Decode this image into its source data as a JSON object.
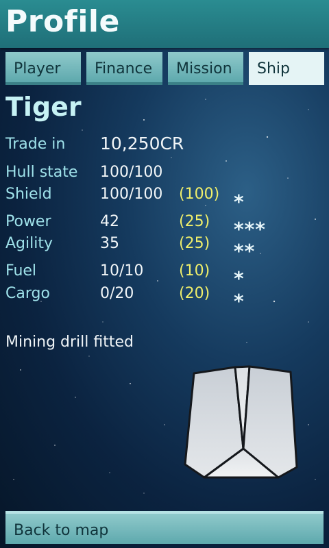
{
  "header": {
    "title": "Profile"
  },
  "tabs": [
    {
      "label": "Player"
    },
    {
      "label": "Finance"
    },
    {
      "label": "Mission"
    },
    {
      "label": "Ship",
      "active": true
    }
  ],
  "ship": {
    "name": "Tiger",
    "trade_in": {
      "label": "Trade in",
      "value": "10,250CR"
    },
    "hull": {
      "label": "Hull state",
      "value": "100/100"
    },
    "stats": [
      {
        "label": "Shield",
        "value": "100/100",
        "max": "(100)",
        "rating": "*"
      },
      {
        "label": "Power",
        "value": "42",
        "max": "(25)",
        "rating": "***"
      },
      {
        "label": "Agility",
        "value": "35",
        "max": "(25)",
        "rating": "**"
      },
      {
        "label": "Fuel",
        "value": "10/10",
        "max": "(10)",
        "rating": "*"
      },
      {
        "label": "Cargo",
        "value": "0/20",
        "max": "(20)",
        "rating": "*"
      }
    ],
    "fitted": "Mining drill fitted"
  },
  "footer": {
    "back_label": "Back to map"
  },
  "colors": {
    "header": "#1f6f78",
    "label": "#9fe2ea",
    "max": "#f0ef6a",
    "tab_active": "#e5f4f5"
  },
  "icons": {
    "ship": "ship-hull-icon"
  }
}
